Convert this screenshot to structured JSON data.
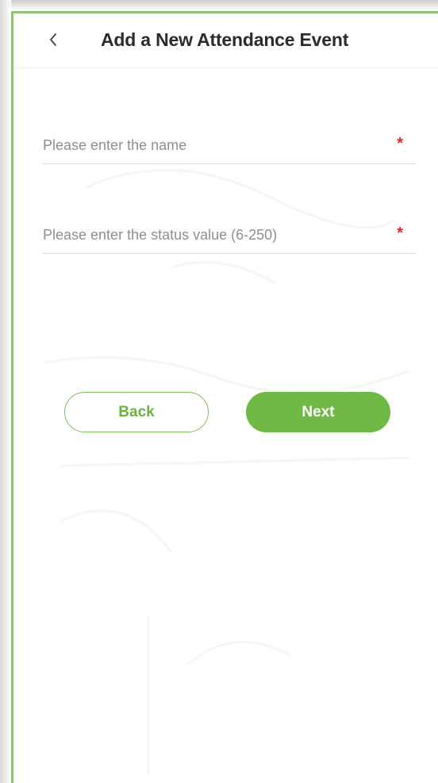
{
  "header": {
    "back_icon": "chevron-left-icon",
    "title": "Add a New Attendance Event"
  },
  "form": {
    "name_field": {
      "placeholder": "Please enter the name",
      "value": "",
      "required_mark": "*"
    },
    "status_field": {
      "placeholder": "Please enter the status value (6-250)",
      "value": "",
      "required_mark": "*"
    }
  },
  "actions": {
    "back_label": "Back",
    "next_label": "Next"
  },
  "colors": {
    "accent": "#70b946",
    "required": "#e02a2a",
    "frame_accent": "#8fc57a"
  }
}
